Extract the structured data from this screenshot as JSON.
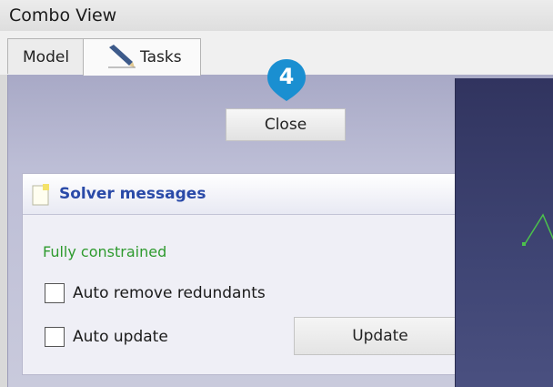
{
  "window": {
    "title": "Combo View"
  },
  "tabs": [
    {
      "label": "Model"
    },
    {
      "label": "Tasks"
    }
  ],
  "step_badge": {
    "number": "4",
    "color": "#1a8fd1"
  },
  "close_button": {
    "label": "Close"
  },
  "solver": {
    "title": "Solver messages",
    "status": "Fully constrained",
    "status_color": "#2e9a2e",
    "auto_remove_label": "Auto remove redundants",
    "auto_remove_checked": false,
    "auto_update_label": "Auto update",
    "auto_update_checked": false,
    "update_button": "Update"
  },
  "icons": {
    "tasks_tab": "pencil-icon",
    "solver_header": "note-icon"
  },
  "colors": {
    "panel_background": "#bdbed6",
    "viewport_background": "#3f4574",
    "sketch_line": "#4cc24c"
  }
}
